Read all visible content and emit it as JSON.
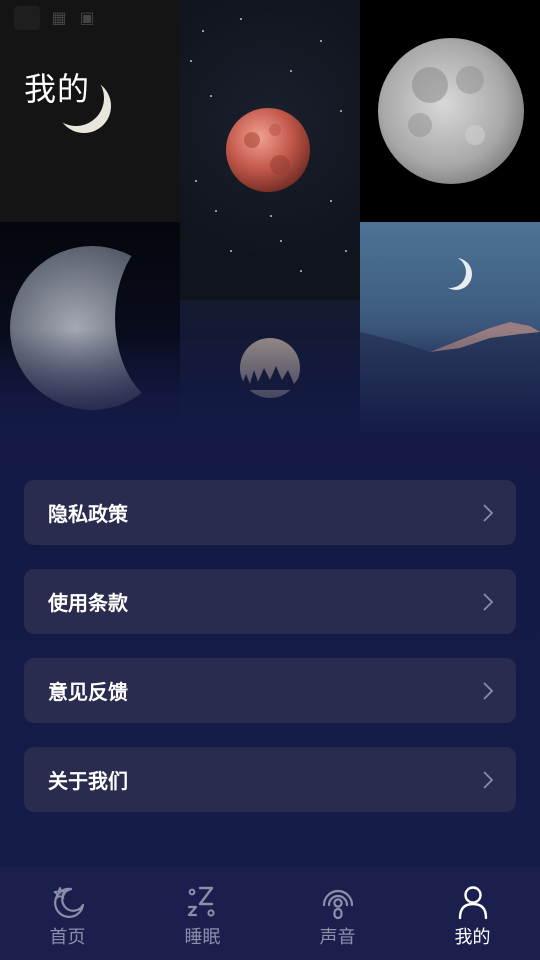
{
  "header": {
    "title": "我的"
  },
  "menu": {
    "items": [
      {
        "label": "隐私政策"
      },
      {
        "label": "使用条款"
      },
      {
        "label": "意见反馈"
      },
      {
        "label": "关于我们"
      }
    ]
  },
  "tabbar": {
    "items": [
      {
        "label": "首页",
        "icon": "moon-star-icon",
        "active": false
      },
      {
        "label": "睡眠",
        "icon": "sleep-z-icon",
        "active": false
      },
      {
        "label": "声音",
        "icon": "sound-wave-icon",
        "active": false
      },
      {
        "label": "我的",
        "icon": "person-icon",
        "active": true
      }
    ]
  },
  "colors": {
    "background": "#131a45",
    "menu_item": "#292b4f",
    "tabbar": "#1b1f4d",
    "tab_inactive": "#8c8faa",
    "tab_active": "#ffffff"
  }
}
